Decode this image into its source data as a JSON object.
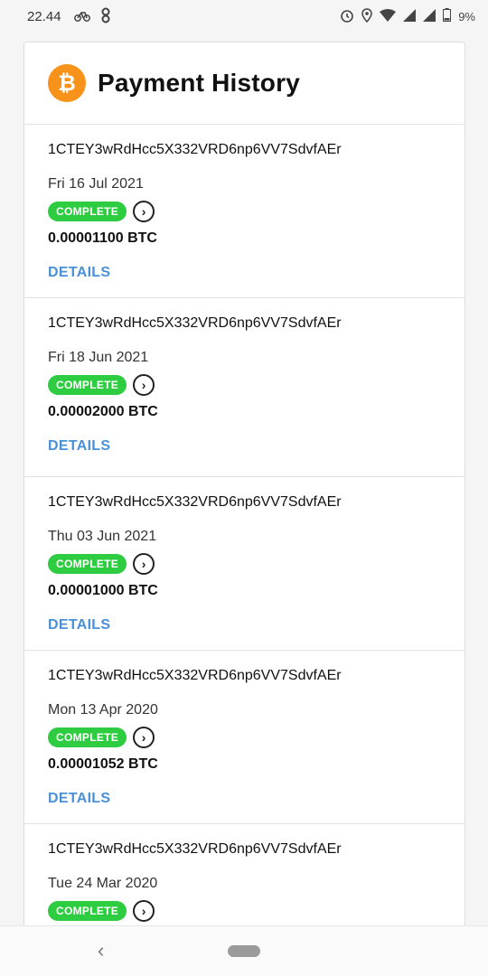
{
  "status_bar": {
    "time": "22.44",
    "left_icons": [
      "bike-icon",
      "infinity-icon"
    ],
    "right_icons": [
      "alarm-icon",
      "location-icon",
      "wifi-icon",
      "signal-icon",
      "signal-icon",
      "battery-icon"
    ],
    "battery": "9%"
  },
  "header": {
    "title": "Payment History",
    "logo_symbol": "₿",
    "logo_color": "#f7931a"
  },
  "payments": [
    {
      "address": "1CTEY3wRdHcc5X332VRD6np6VV7SdvfAEr",
      "date": "Fri 16 Jul 2021",
      "status": "COMPLETE",
      "amount": "0.00001100 BTC",
      "details_label": "DETAILS"
    },
    {
      "address": "1CTEY3wRdHcc5X332VRD6np6VV7SdvfAEr",
      "date": "Fri 18 Jun 2021",
      "status": "COMPLETE",
      "amount": "0.00002000 BTC",
      "details_label": "DETAILS"
    },
    {
      "address": "1CTEY3wRdHcc5X332VRD6np6VV7SdvfAEr",
      "date": "Thu 03 Jun 2021",
      "status": "COMPLETE",
      "amount": "0.00001000 BTC",
      "details_label": "DETAILS"
    },
    {
      "address": "1CTEY3wRdHcc5X332VRD6np6VV7SdvfAEr",
      "date": "Mon 13 Apr 2020",
      "status": "COMPLETE",
      "amount": "0.00001052 BTC",
      "details_label": "DETAILS"
    },
    {
      "address": "1CTEY3wRdHcc5X332VRD6np6VV7SdvfAEr",
      "date": "Tue 24 Mar 2020",
      "status": "COMPLETE"
    }
  ],
  "colors": {
    "status_complete": "#2ecc40",
    "link": "#4a90d9"
  },
  "nav_bar": {
    "back_symbol": "‹"
  }
}
